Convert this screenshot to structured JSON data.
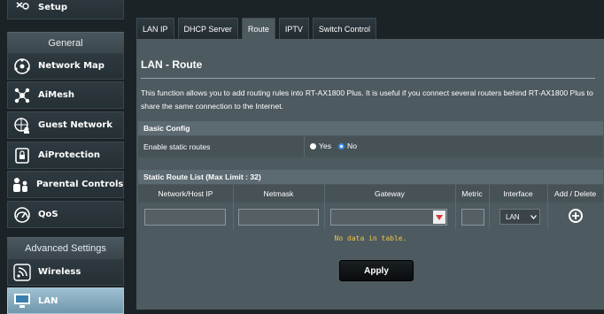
{
  "sidebar": {
    "setup_label": "Setup",
    "general_heading": "General",
    "items": [
      {
        "label": "Network Map",
        "icon": "network-map-icon"
      },
      {
        "label": "AiMesh",
        "icon": "aimesh-icon"
      },
      {
        "label": "Guest Network",
        "icon": "guest-network-icon"
      },
      {
        "label": "AiProtection",
        "icon": "lock-icon"
      },
      {
        "label": "Parental Controls",
        "icon": "parental-controls-icon"
      },
      {
        "label": "QoS",
        "icon": "qos-icon"
      }
    ],
    "advanced_heading": "Advanced Settings",
    "advanced_items": [
      {
        "label": "Wireless",
        "icon": "wireless-icon"
      },
      {
        "label": "LAN",
        "icon": "lan-icon"
      }
    ]
  },
  "tabs": [
    {
      "label": "LAN IP"
    },
    {
      "label": "DHCP Server"
    },
    {
      "label": "Route"
    },
    {
      "label": "IPTV"
    },
    {
      "label": "Switch Control"
    }
  ],
  "page": {
    "title": "LAN - Route",
    "description": "This function allows you to add routing rules into RT-AX1800 Plus. It is useful if you connect several routers behind RT-AX1800 Plus to share the same connection to the Internet."
  },
  "basic_config": {
    "heading": "Basic Config",
    "enable_label": "Enable static routes",
    "yes_label": "Yes",
    "no_label": "No",
    "selected": "No"
  },
  "route_list": {
    "heading": "Static Route List (Max Limit : 32)",
    "columns": [
      "Network/Host IP",
      "Netmask",
      "Gateway",
      "Metric",
      "Interface",
      "Add / Delete"
    ],
    "interface_value": "LAN",
    "empty_text": "No data in table."
  },
  "apply_label": "Apply",
  "colors": {
    "accent_blue": "#2f8ff5",
    "empty_text": "#f0c54a",
    "panel": "#4d5a60"
  }
}
